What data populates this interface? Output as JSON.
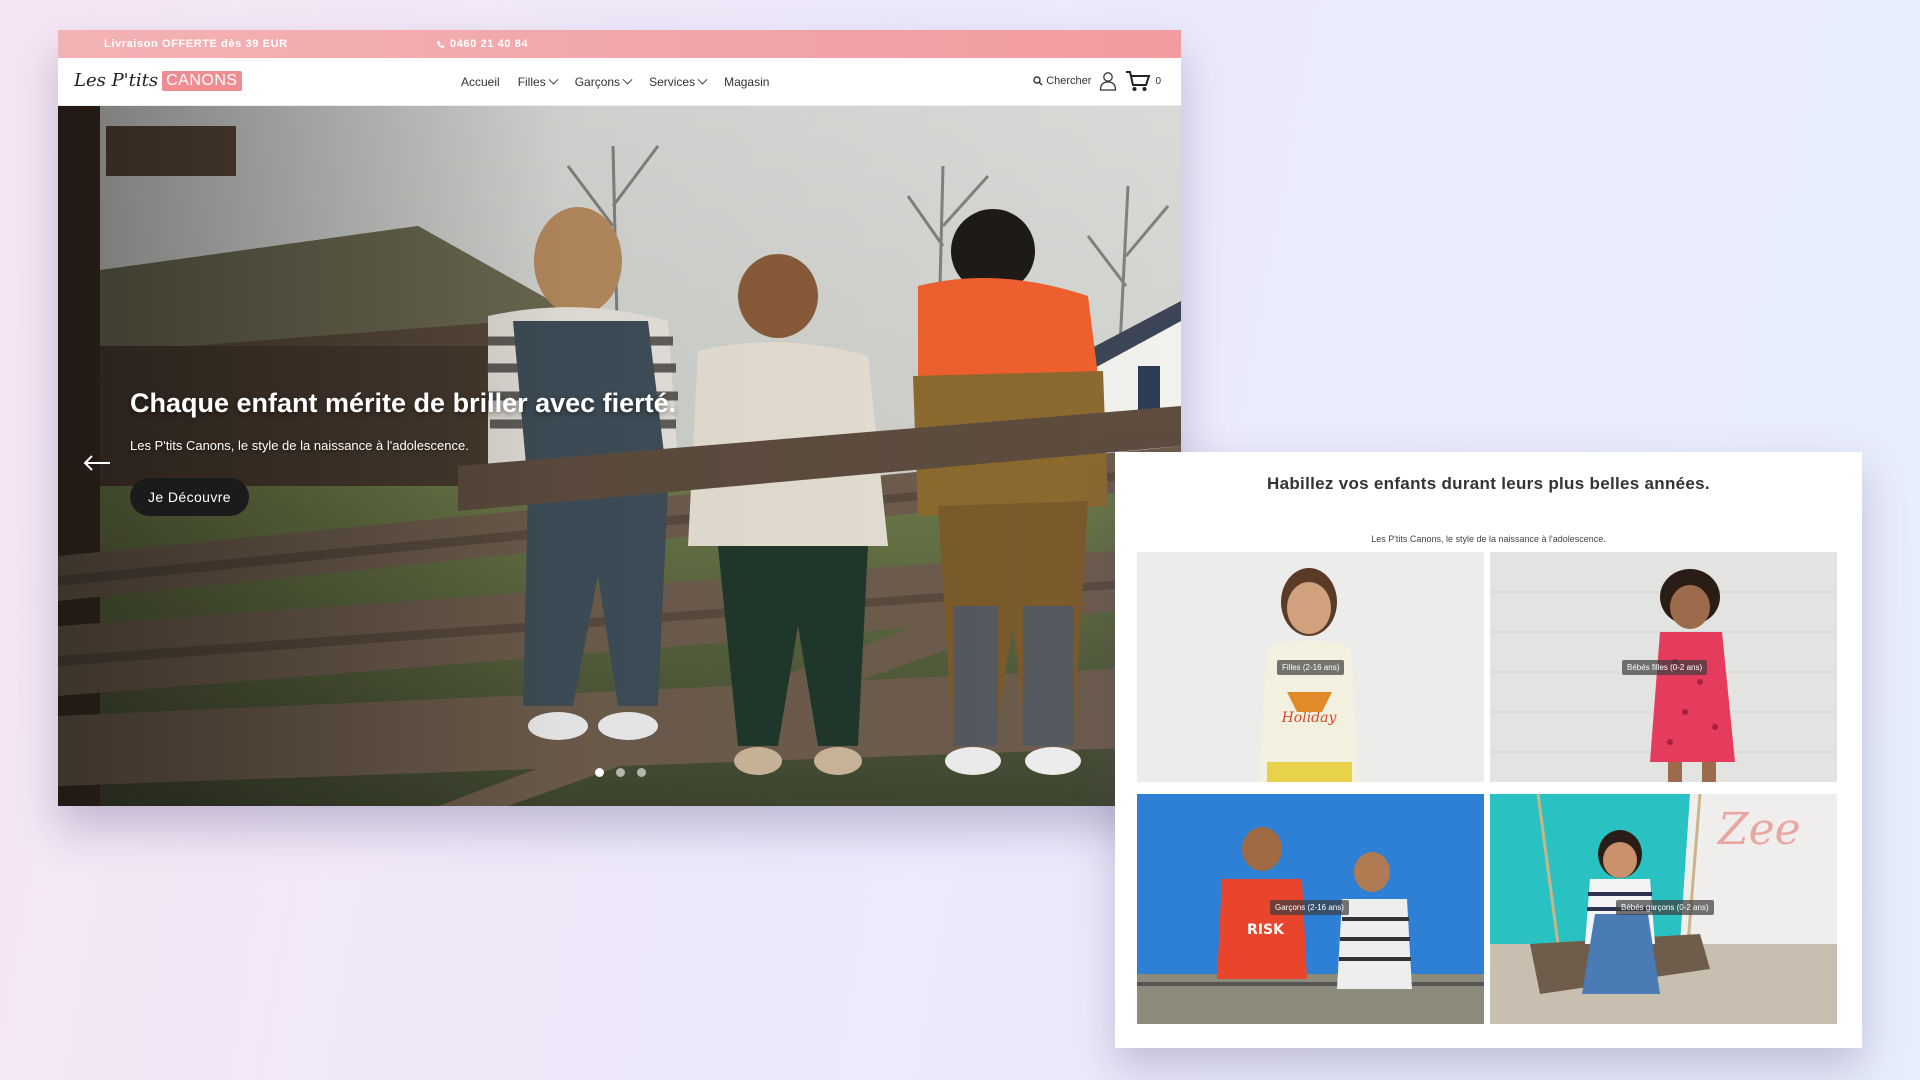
{
  "colors": {
    "accent": "#f08d93",
    "topbar": "#f3b2b5",
    "dark_button": "#1b1b1b",
    "cyan_wall": "#2ac1c3",
    "sky_blue": "#2e7fd6"
  },
  "topbar": {
    "promo": "Livraison OFFERTE dès 39 EUR",
    "phone": "0460 21 40 84",
    "phone_icon": "phone-icon"
  },
  "brand": {
    "part1": "Les P'tits",
    "part2": "CANONS"
  },
  "nav": {
    "items": [
      {
        "label": "Accueil",
        "dropdown": false
      },
      {
        "label": "Filles",
        "dropdown": true
      },
      {
        "label": "Garçons",
        "dropdown": true
      },
      {
        "label": "Services",
        "dropdown": true
      },
      {
        "label": "Magasin",
        "dropdown": false
      }
    ],
    "search_label": "Chercher",
    "cart_count": "0",
    "icons": [
      "search-icon",
      "user-icon",
      "cart-icon"
    ]
  },
  "hero": {
    "title": "Chaque enfant mérite de briller avec fierté.",
    "subtitle": "Les P'tits Canons, le style de la naissance à l'adolescence.",
    "button": "Je Découvre",
    "slides": 3,
    "active_slide": 0
  },
  "categories": {
    "title": "Habillez vos enfants durant leurs plus belles années.",
    "subtitle": "Les P'tits Canons, le style de la naissance à l'adolescence.",
    "tiles": [
      {
        "label": "Filles (2-16 ans)"
      },
      {
        "label": "Bébés filles (0-2 ans)"
      },
      {
        "label": "Garçons (2-16 ans)"
      },
      {
        "label": "Bébés garçons (0-2 ans)"
      }
    ]
  }
}
